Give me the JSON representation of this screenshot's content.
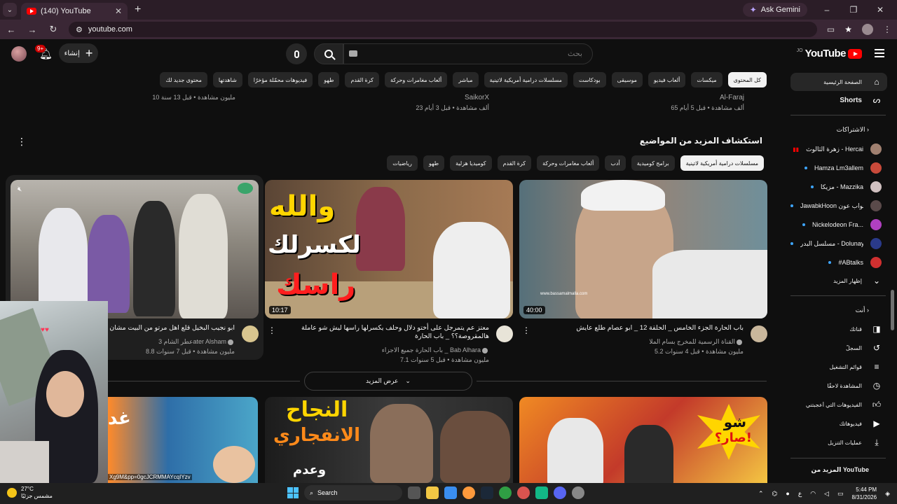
{
  "browser": {
    "tab_title": "(140) YouTube",
    "ask_gemini": "Ask Gemini",
    "url": "youtube.com"
  },
  "header": {
    "notifications_badge": "9+",
    "create_label": "إنشاء",
    "search_placeholder": "بحث",
    "logo_text": "YouTube",
    "logo_region": "JO"
  },
  "chips": [
    "كل المحتوى",
    "ميكسات",
    "ألعاب فيديو",
    "موسيقى",
    "بودكاست",
    "مسلسلات درامية أمريكية لاتينية",
    "مباشر",
    "ألعاب مغامرات وحركة",
    "كرة القدم",
    "طهو",
    "فيديوهات محمّلة مؤخرًا",
    "شاهدتها",
    "محتوى جديد لك"
  ],
  "top_row": {
    "card1_channel": "Al-Faraj",
    "card1_meta": "65 ألف مشاهدة • قبل 5 أيام",
    "card2_channel": "SaikorX",
    "card2_meta": "23 ألف مشاهدة • قبل 3 أيام",
    "card3_meta": "10 مليون مشاهدة • قبل 13 سنة"
  },
  "explore": {
    "title": "استكشاف المزيد من المواضيع",
    "chips": [
      "مسلسلات درامية أمريكية لاتينية",
      "برامج كوميدية",
      "أدب",
      "ألعاب مغامرات وحركة",
      "كرة القدم",
      "كوميديا هزلية",
      "طهو",
      "رياضيات"
    ],
    "show_more": "عرض المزيد"
  },
  "videos": [
    {
      "title": "باب الحارة الجزء الخامس _ الحلقة 12 _ ابو عصام طلع عايش",
      "channel": "القناة الرسمية للمخرج بسام الملا",
      "meta": "5.2 مليون مشاهدة • قبل 4 سنوات",
      "duration": "40:00",
      "thumb_text": "www.bassamalmalla.com"
    },
    {
      "title": "معتز عم يتمرجل على أختو دلال وحلف يكسرلها راسها ليش شو عاملة هالمقروصة؟؟ _ باب الحارة",
      "channel": "باب الحارة جميع الاجزاء _ Bab Alhara",
      "meta": "7.1 مليون مشاهدة • قبل 5 سنوات",
      "duration": "10:17",
      "thumb_text_1": "والله",
      "thumb_text_2": "لكسرلك",
      "thumb_text_3": "راسك"
    },
    {
      "title": "ابو نجيب البخيل قلع اهل مرتو من البيت مشان عقود ع",
      "channel": "عطر الشام 3ater Alsham",
      "meta": "8.8 مليون مشاهدة • قبل 7 سنوات"
    },
    {
      "thumb_text_1": "شو",
      "thumb_text_2": "صار؟!"
    },
    {
      "thumb_text_1": "النجاح",
      "thumb_text_2": "الانفجاري",
      "thumb_text_3": "وعدم"
    },
    {
      "thumb_text": "غد",
      "overlay_url": "Xg9M&pp=0gcJCRMMAYcqIYzv"
    }
  ],
  "sidebar": {
    "home": "الصفحة الرئيسية",
    "shorts": "Shorts",
    "subscriptions_title": "الاشتراكات",
    "subscriptions": [
      {
        "name": "زهرة الثالوث - Hercai",
        "live": true
      },
      {
        "name": "Hamza Lm3allem",
        "live": false
      },
      {
        "name": "مزيكا - Mazzika",
        "live": false
      },
      {
        "name": "JawabkHoon جواب عون",
        "live": false
      },
      {
        "name": "Nickelodeon Fra...",
        "live": false
      },
      {
        "name": "مسلسل البدر - Dolunay",
        "live": false
      },
      {
        "name": "#ABtalks",
        "live": false
      }
    ],
    "show_more": "إظهار المزيد",
    "you_title": "أنت",
    "you_items": [
      "قناتك",
      "السجلّ",
      "قوائم التشغيل",
      "المشاهدة لاحقًا",
      "الفيديوهات التي أعجبتني",
      "فيديوهاتك",
      "عمليات التنزيل"
    ],
    "more_from": "المزيد من YouTube"
  },
  "taskbar": {
    "temp": "27°C",
    "weather": "مشمس جزئيًا",
    "search": "Search",
    "time": "5:44 PM",
    "date": "8/31/2026",
    "lang": "ع"
  }
}
